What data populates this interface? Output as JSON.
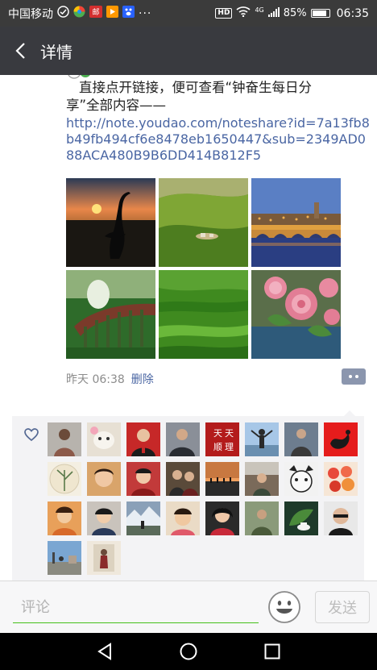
{
  "status_bar": {
    "carrier": "中国移动",
    "app_icons": [
      "wechat-status-icon",
      "browser-status-icon",
      "mail-status-icon",
      "video-status-icon",
      "baidu-status-icon"
    ],
    "more": "···",
    "hd": "HD",
    "network": "4G",
    "battery_percent": "85%",
    "battery_level": 0.85,
    "time": "06:35"
  },
  "header": {
    "back_icon": "chevron-left-icon",
    "title": "详情"
  },
  "post": {
    "text_line1": "直接点开链接，便可查看“钟奋生每日分",
    "text_line2": "享”全部内容——",
    "link": "http://note.youdao.com/noteshare?id=7a13fb8b49fb494cf6e8478eb1650447&sub=2349AD088ACA480B9B6DD414B812F5",
    "photos": [
      {
        "name": "photo-crane-sunset"
      },
      {
        "name": "photo-green-hills"
      },
      {
        "name": "photo-bridge-town-night"
      },
      {
        "name": "photo-steam-train-viaduct"
      },
      {
        "name": "photo-green-grassland"
      },
      {
        "name": "photo-pink-roses"
      }
    ],
    "time": "昨天 06:38",
    "delete_label": "删除",
    "comment_icon": "more-actions-icon"
  },
  "likes": {
    "heart_icon": "heart-outline-icon",
    "liker_count": 26
  },
  "input_bar": {
    "placeholder": "评论",
    "emoji_icon": "emoji-icon",
    "send_label": "发送"
  },
  "nav_bar": {
    "back": "nav-back-icon",
    "home": "nav-home-icon",
    "recents": "nav-recents-icon"
  },
  "colors": {
    "status_bar": "#3b3b3b",
    "title_bar": "#393a3f",
    "link": "#4a66a3",
    "likes_bg": "#f3f3f5",
    "input_underline": "#45c01a"
  }
}
